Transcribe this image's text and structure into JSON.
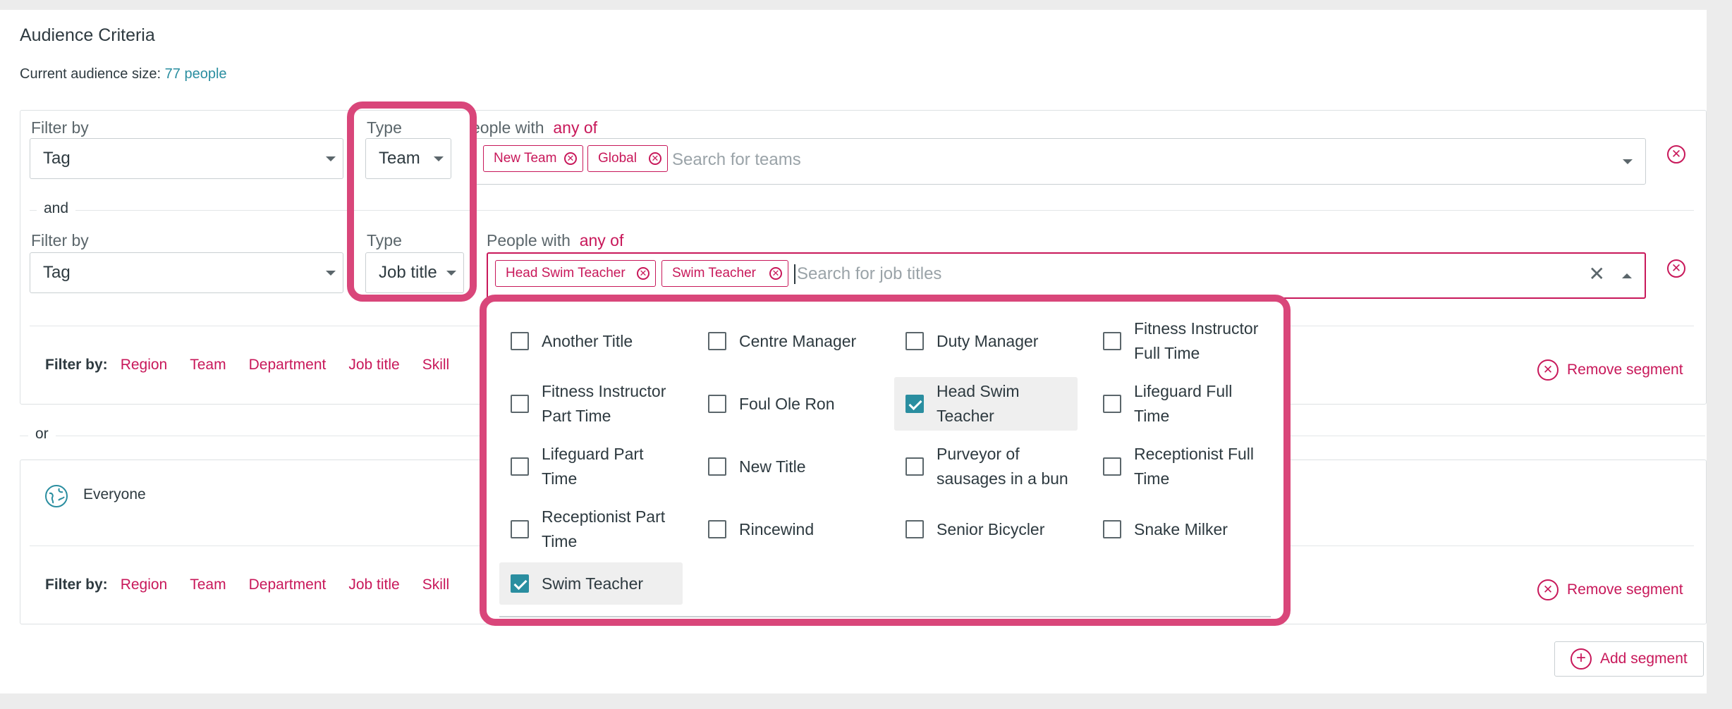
{
  "header": {
    "title": "Audience Criteria",
    "size_prefix": "Current audience size: ",
    "size_value": "77 people"
  },
  "segment1": {
    "row1": {
      "filter_label": "Filter by",
      "filter_value": "Tag",
      "type_label": "Type",
      "type_value": "Team",
      "people_label": "eople with",
      "people_qualifier": "any of",
      "tags": [
        {
          "label": "New Team"
        },
        {
          "label": "Global"
        }
      ],
      "search_placeholder": "Search for teams"
    },
    "and_label": "and",
    "row2": {
      "filter_label": "Filter by",
      "filter_value": "Tag",
      "type_label": "Type",
      "type_value": "Job title",
      "people_label": "People with",
      "people_qualifier": "any of",
      "tags": [
        {
          "label": "Head Swim Teacher"
        },
        {
          "label": "Swim Teacher"
        }
      ],
      "search_placeholder": "Search for job titles"
    },
    "filter_bar": {
      "label": "Filter by:",
      "links": [
        "Region",
        "Team",
        "Department",
        "Job title",
        "Skill"
      ]
    },
    "remove_label": "Remove segment"
  },
  "or_label": "or",
  "segment2": {
    "everyone_label": "Everyone",
    "filter_bar": {
      "label": "Filter by:",
      "links": [
        "Region",
        "Team",
        "Department",
        "Job title",
        "Skill"
      ]
    },
    "remove_label": "Remove segment"
  },
  "add_segment_label": "Add segment",
  "dropdown": {
    "options": [
      {
        "label": "Another Title",
        "checked": false
      },
      {
        "label": "Centre Manager",
        "checked": false
      },
      {
        "label": "Duty Manager",
        "checked": false
      },
      {
        "label": "Fitness Instructor Full Time",
        "checked": false
      },
      {
        "label": "Fitness Instructor Part Time",
        "checked": false
      },
      {
        "label": "Foul Ole Ron",
        "checked": false
      },
      {
        "label": "Head Swim Teacher",
        "checked": true
      },
      {
        "label": "Lifeguard Full Time",
        "checked": false
      },
      {
        "label": "Lifeguard Part Time",
        "checked": false
      },
      {
        "label": "New Title",
        "checked": false
      },
      {
        "label": "Purveyor of sausages in a bun",
        "checked": false
      },
      {
        "label": "Receptionist Full Time",
        "checked": false
      },
      {
        "label": "Receptionist Part Time",
        "checked": false
      },
      {
        "label": "Rincewind",
        "checked": false
      },
      {
        "label": "Senior Bicycler",
        "checked": false
      },
      {
        "label": "Snake Milker",
        "checked": false
      },
      {
        "label": "Swim Teacher",
        "checked": true
      }
    ]
  },
  "icons": {
    "remove": "circle-x-icon",
    "caret": "caret-down-icon",
    "clear": "close-icon",
    "everyone": "globe-icon",
    "add": "plus-circle-icon"
  },
  "colors": {
    "accent": "#c8185a",
    "teal": "#2a8ea0",
    "highlight": "#d9467a"
  }
}
